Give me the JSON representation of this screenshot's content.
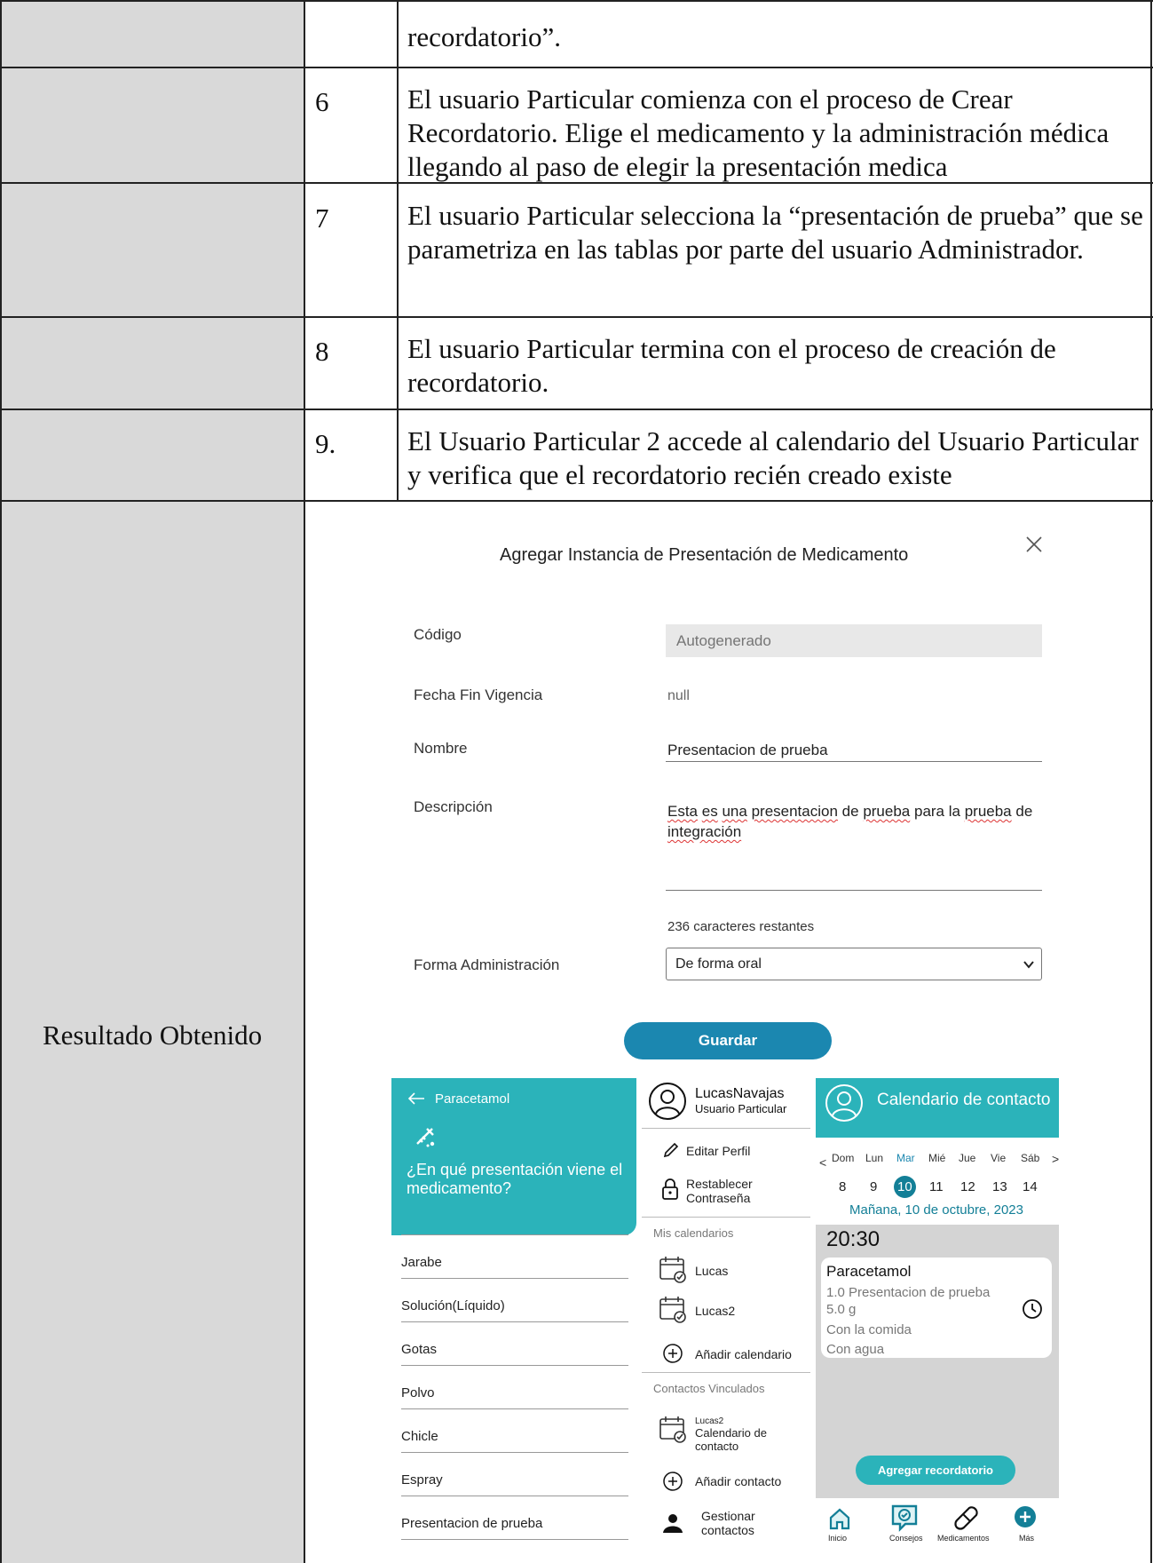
{
  "doc": {
    "rows": [
      {
        "num": "",
        "text": "recordatorio”."
      },
      {
        "num": "6",
        "text": "El usuario Particular comienza con el proceso de Crear Recordatorio. Elige el medicamento y la administración médica llegando al paso de elegir la presentación medica"
      },
      {
        "num": "7",
        "text": "El usuario Particular selecciona la “presentación de prueba” que se parametriza en las tablas por parte del usuario Administrador."
      },
      {
        "num": "8",
        "text": "El usuario Particular termina con el proceso de creación de recordatorio."
      },
      {
        "num": "9.",
        "text": "El Usuario Particular 2 accede al calendario del Usuario Particular y verifica que el recordatorio recién creado existe"
      }
    ],
    "result_label": "Resultado Obtenido"
  },
  "modal": {
    "title": "Agregar Instancia de Presentación de Medicamento",
    "close_icon": "close-icon",
    "fields": {
      "codigo_label": "Código",
      "codigo_placeholder": "Autogenerado",
      "fecha_label": "Fecha Fin Vigencia",
      "fecha_value": "null",
      "nombre_label": "Nombre",
      "nombre_value": "Presentacion de prueba",
      "descripcion_label": "Descripción",
      "descripcion_w1": "Esta",
      "descripcion_w2": "es",
      "descripcion_w3": "una",
      "descripcion_w4": "presentacion",
      "descripcion_w5": "de",
      "descripcion_w6": "prueba",
      "descripcion_w7": "para la",
      "descripcion_w8": "prueba",
      "descripcion_w9": "de",
      "descripcion_w10": "integración",
      "chars_left": "236 caracteres restantes",
      "forma_label": "Forma Administración",
      "forma_value": "De forma oral"
    },
    "save_label": "Guardar",
    "accent": "#1b87b0"
  },
  "presentation_panel": {
    "back_label": "Paracetamol",
    "question": "¿En qué presentación viene el medicamento?",
    "options": [
      "Jarabe",
      "Solución(Líquido)",
      "Gotas",
      "Polvo",
      "Chicle",
      "Espray",
      "Presentacion de prueba"
    ],
    "accent": "#2bb3ba"
  },
  "profile_panel": {
    "user_name": "LucasNavajas",
    "user_role": "Usuario Particular",
    "edit_profile": "Editar Perfil",
    "reset_password_1": "Restablecer",
    "reset_password_2": "Contraseña",
    "my_calendars_title": "Mis calendarios",
    "calendars": [
      "Lucas",
      "Lucas2"
    ],
    "add_calendar": "Añadir calendario",
    "linked_contacts_title": "Contactos Vinculados",
    "contact_name": "Lucas2",
    "contact_cal_1": "Calendario de",
    "contact_cal_2": "contacto",
    "add_contact": "Añadir contacto",
    "manage_contacts_1": "Gestionar",
    "manage_contacts_2": "contactos"
  },
  "calendar_panel": {
    "title": "Calendario de contacto",
    "weekdays": [
      "Dom",
      "Lun",
      "Mar",
      "Mié",
      "Jue",
      "Vie",
      "Sáb"
    ],
    "days": [
      "8",
      "9",
      "10",
      "11",
      "12",
      "13",
      "14"
    ],
    "selected_day": "10",
    "date_caption": "Mañana, 10 de octubre, 2023",
    "time": "20:30",
    "reminder": {
      "name": "Paracetamol",
      "line1": "1.0 Presentacion de prueba",
      "line2": "5.0 g",
      "line3": "Con la comida",
      "line4": "Con agua"
    },
    "add_reminder": "Agregar recordatorio",
    "nav": [
      "Inicio",
      "Consejos",
      "Medicamentos",
      "Más"
    ],
    "accent": "#2bb3ba"
  }
}
